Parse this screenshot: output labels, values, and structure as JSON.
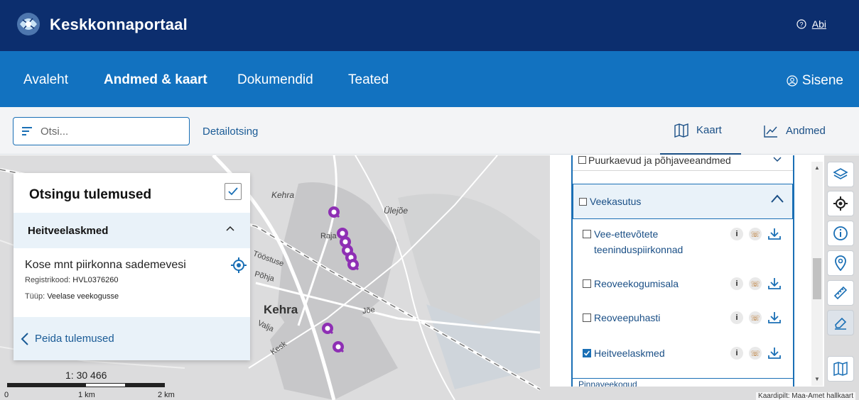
{
  "header": {
    "brand": "Keskkonnaportaal",
    "help_label": "Abi",
    "logo": "globe-leaf-logo"
  },
  "nav": {
    "items": [
      "Avaleht",
      "Andmed & kaart",
      "Dokumendid",
      "Teated"
    ],
    "active": "Andmed & kaart",
    "login_label": "Sisene"
  },
  "toolbar": {
    "search_placeholder": "Otsi...",
    "detail_search": "Detailotsing",
    "tab_map": "Kaart",
    "tab_data": "Andmed"
  },
  "map": {
    "labels": [
      "Kehra",
      "Ülejõe",
      "Kehra",
      "Raja",
      "Tööstuse",
      "Põhja",
      "Jõe",
      "Valja",
      "Kesk"
    ],
    "scale_ratio": "1: 30 466",
    "scale_ticks": [
      "0",
      "1 km",
      "2 km"
    ],
    "credit": "Kaardipilt: Maa-Amet hallkaart"
  },
  "results": {
    "title": "Otsingu tulemused",
    "section": "Heitveelaskmed",
    "item": {
      "name": "Kose mnt piirkonna sademevesi",
      "reg_label": "Registrikood: ",
      "reg_value": "HVL0376260",
      "type_label": "Tüüp: ",
      "type_value": "Veelase veekogusse"
    },
    "hide_label": "Peida tulemused"
  },
  "layers": {
    "top_partial": "Puurkaevud ja põhjaveeandmed",
    "group": "Veekasutus",
    "rows": [
      {
        "name": "Vee-ettevõtete teeninduspiirkonnad",
        "checked": false
      },
      {
        "name": "Reoveekogumisala",
        "checked": false
      },
      {
        "name": "Reoveepuhasti",
        "checked": false
      },
      {
        "name": "Heitveelaskmed",
        "checked": true
      }
    ],
    "next_partial": "Pinnaveekogud"
  },
  "colors": {
    "topbar": "#0c2e6e",
    "navbar": "#1272c0",
    "accent": "#1a6fb5",
    "pin": "#8e2fb4"
  },
  "tool_icons": [
    "layers-icon",
    "locate-icon",
    "info-icon",
    "pin-icon",
    "ruler-icon",
    "eraser-icon",
    "map-icon"
  ]
}
